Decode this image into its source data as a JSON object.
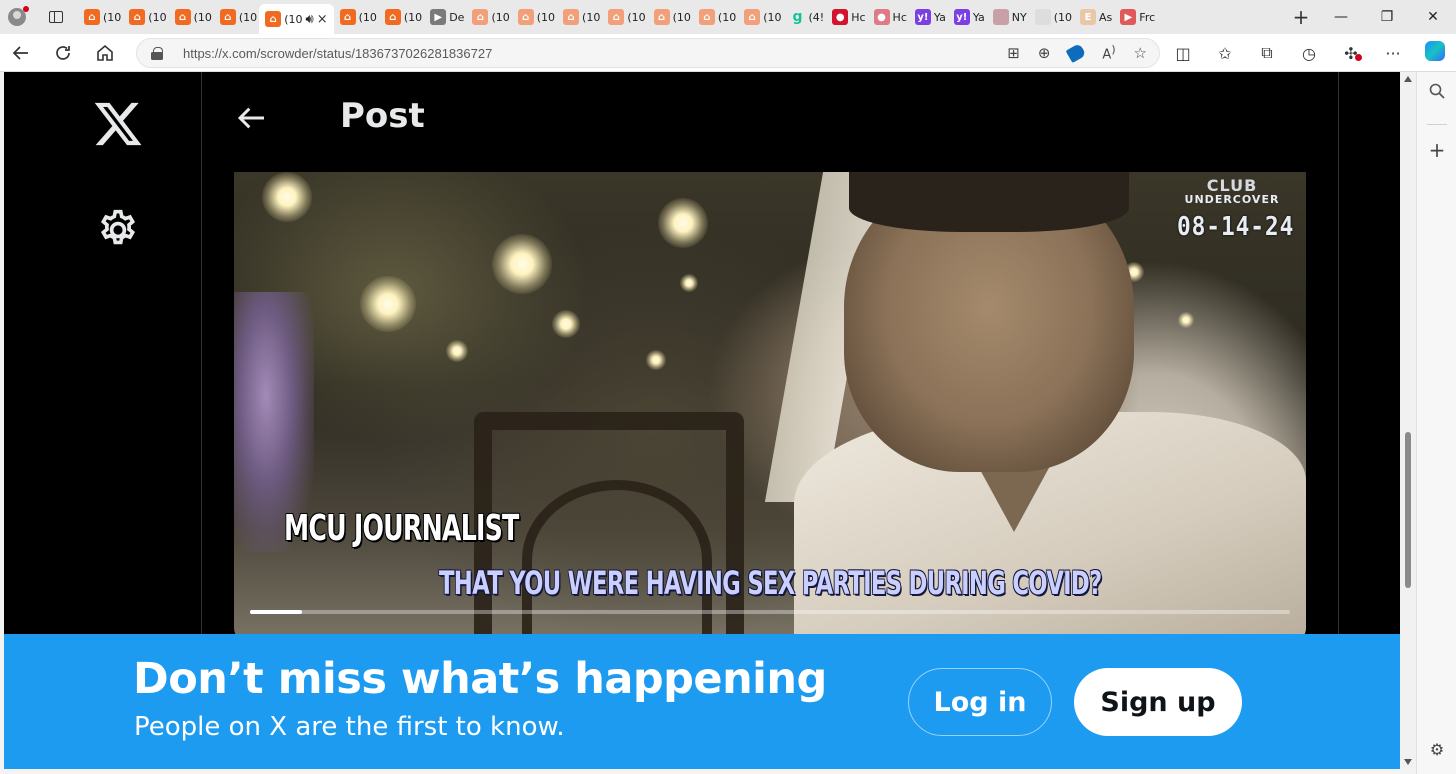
{
  "browser": {
    "tabs": [
      {
        "label": "(10",
        "icon": "bookmark-orange-icon",
        "color": "#f06a21"
      },
      {
        "label": "(10",
        "icon": "bookmark-orange-icon",
        "color": "#f06a21"
      },
      {
        "label": "(10",
        "icon": "bookmark-orange-icon",
        "color": "#f06a21"
      },
      {
        "label": "(10",
        "icon": "bookmark-orange-icon",
        "color": "#f06a21"
      },
      {
        "label": "(10",
        "icon": "bookmark-orange-icon",
        "color": "#f06a21"
      },
      {
        "label": "(10",
        "icon": "bookmark-orange-icon",
        "color": "#f06a21"
      },
      {
        "label": "De",
        "icon": "media-icon",
        "color": "#7a7a7a"
      },
      {
        "label": "(10",
        "icon": "bookmark-orange-icon",
        "color": "#f2a07a"
      },
      {
        "label": "(10",
        "icon": "bookmark-orange-icon",
        "color": "#f2a07a"
      },
      {
        "label": "(10",
        "icon": "bookmark-orange-icon",
        "color": "#f2a07a"
      },
      {
        "label": "(10",
        "icon": "bookmark-orange-icon",
        "color": "#f2a07a"
      },
      {
        "label": "(10",
        "icon": "bookmark-orange-icon",
        "color": "#f2a07a"
      },
      {
        "label": "(10",
        "icon": "bookmark-orange-icon",
        "color": "#f2a07a"
      },
      {
        "label": "(10",
        "icon": "bookmark-orange-icon",
        "color": "#f2a07a"
      },
      {
        "label": "(4!",
        "icon": "g-icon",
        "color": "#15c39a"
      },
      {
        "label": "Hc",
        "icon": "red-badge-icon",
        "color": "#d3132f"
      },
      {
        "label": "Hc",
        "icon": "red-badge-icon",
        "color": "#e07a86"
      },
      {
        "label": "Ya",
        "icon": "yahoo-icon",
        "color": "#7b3fe4"
      },
      {
        "label": "Ya",
        "icon": "yahoo-icon",
        "color": "#7b3fe4"
      },
      {
        "label": "NY",
        "icon": "news-icon",
        "color": "#c7a0a8"
      },
      {
        "label": "(10",
        "icon": "blank-icon",
        "color": "#dddddd"
      },
      {
        "label": "As",
        "icon": "e-icon",
        "color": "#e9c8a8"
      },
      {
        "label": "Frc",
        "icon": "youtube-icon",
        "color": "#e05a5a"
      }
    ],
    "active_tab": {
      "label": "(10",
      "icon": "speaker-icon",
      "close": "×"
    },
    "url": "https://x.com/scrowder/status/1836737026281836727",
    "newtab": "+",
    "window_controls": [
      "—",
      "❐",
      "✕"
    ]
  },
  "sidebar": {
    "logo_name": "x-logo-icon",
    "settings_name": "settings-gear-icon"
  },
  "header": {
    "title": "Post"
  },
  "video": {
    "brand_line1": "CLUB",
    "brand_line2": "UNDERCOVER",
    "date": "08-14-24",
    "speaker": "MCU JOURNALIST",
    "caption": "THAT YOU WERE HAVING SEX PARTIES DURING COVID?",
    "progress_fraction": 0.05
  },
  "banner": {
    "title": "Don’t miss what’s happening",
    "subtitle": "People on X are the first to know.",
    "login_label": "Log in",
    "signup_label": "Sign up",
    "color": "#1d9bf0"
  }
}
